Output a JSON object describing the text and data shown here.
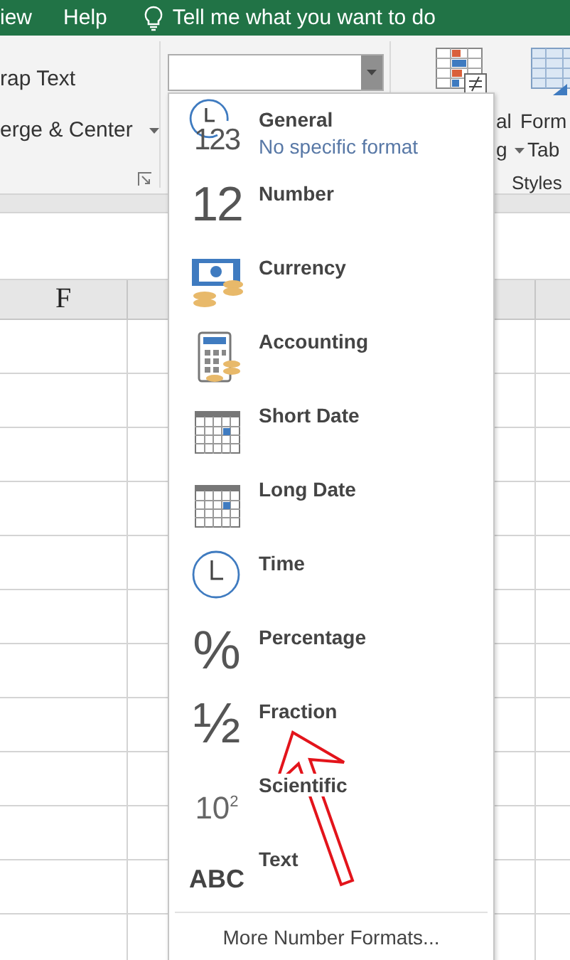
{
  "menu_bar": {
    "tabs": [
      {
        "label": "iew"
      },
      {
        "label": "Help"
      }
    ],
    "tell_me": "Tell me what you want to do"
  },
  "ribbon": {
    "alignment_buttons": [
      {
        "label": "rap Text"
      },
      {
        "label": "erge & Center",
        "has_caret": true
      }
    ],
    "number_format_box": {
      "expanded": true
    },
    "styles_buttons": [
      {
        "kind": "conditional",
        "lines": [
          "al",
          "g"
        ],
        "has_caret": true
      },
      {
        "kind": "table",
        "lines": [
          "Form",
          "Tab"
        ]
      }
    ],
    "styles_label": "Styles"
  },
  "grid": {
    "columns": [
      "F"
    ]
  },
  "format_menu": {
    "items": [
      {
        "kind": "general",
        "icon_text": "123",
        "label": "General",
        "description": "No specific format"
      },
      {
        "kind": "number",
        "icon_text": "12",
        "label": "Number"
      },
      {
        "kind": "currency",
        "label": "Currency"
      },
      {
        "kind": "accounting",
        "label": "Accounting"
      },
      {
        "kind": "short-date",
        "label": "Short Date"
      },
      {
        "kind": "long-date",
        "label": "Long Date"
      },
      {
        "kind": "time",
        "label": "Time"
      },
      {
        "kind": "percentage",
        "icon_text": "%",
        "label": "Percentage"
      },
      {
        "kind": "fraction",
        "icon_text": "½",
        "label": "Fraction"
      },
      {
        "kind": "scientific",
        "icon_text": "10$^{2}$",
        "label": "Scientific"
      },
      {
        "kind": "text",
        "icon_text": "ABC",
        "label": "Text"
      }
    ],
    "footer": "More Number Formats..."
  },
  "annotations": [
    {
      "kind": "arrow"
    }
  ]
}
